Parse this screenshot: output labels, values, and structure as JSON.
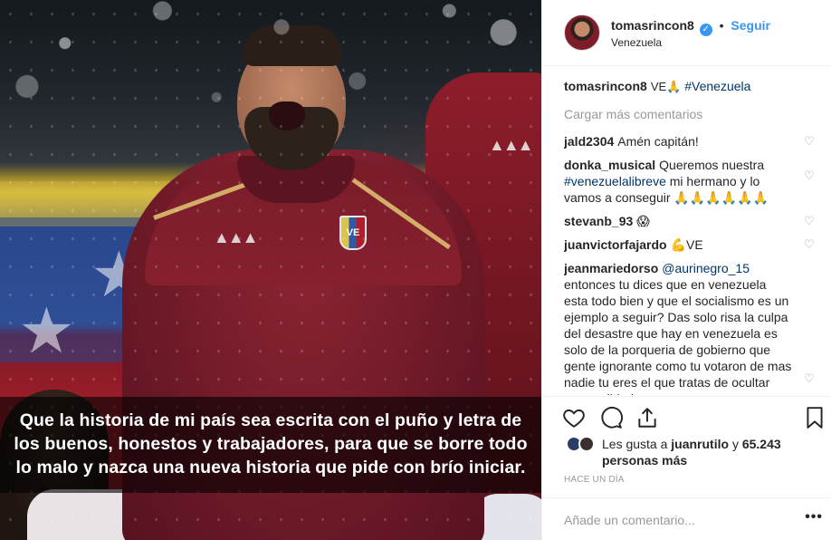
{
  "post": {
    "caption_overlay": "Que la historia de mi país sea escrita con el puño y letra de los buenos, honestos y trabajadores, para que se borre todo lo malo y nazca una nueva historia que pide con brío iniciar.",
    "crest_text": "VE"
  },
  "header": {
    "username": "tomasrincon8",
    "follow_label": "Seguir",
    "location": "Venezuela",
    "separator": "•"
  },
  "caption": {
    "username": "tomasrincon8",
    "text": "VE🙏",
    "hashtag": "#Venezuela"
  },
  "load_more_label": "Cargar más comentarios",
  "comments": [
    {
      "username": "jald2304",
      "text": "Amén capitán!",
      "mention": ""
    },
    {
      "username": "donka_musical",
      "text": "Queremos nuestra",
      "mention": "#venezuelalibreve",
      "text_after": " mi hermano y lo vamos a conseguir 🙏🙏🙏🙏🙏🙏"
    },
    {
      "username": "stevanb_93",
      "text": "😱",
      "mention": ""
    },
    {
      "username": "juanvictorfajardo",
      "text": "💪VE",
      "mention": ""
    },
    {
      "username": "jeanmariedorso",
      "mention": "@aurinegro_15",
      "text": "entonces tu dices que en venezuela esta todo bien y que el socialismo es un ejemplo a seguir? Das solo risa la culpa del desastre que hay en venezuela es solo de la porqueria de gobierno que gente ignorante como tu votaron de mas nadie tu eres el que tratas de ocultar una realidad que es"
    }
  ],
  "likes": {
    "prefix": "Les gusta a",
    "user": "juanrutilo",
    "conj": "y",
    "count": "65.243 personas más"
  },
  "timestamp": "HACE UN DÍA",
  "add_comment": {
    "placeholder": "Añade un comentario...",
    "more": "•••"
  },
  "icons": [
    "heart-icon",
    "comment-icon",
    "share-icon",
    "bookmark-icon",
    "verified-icon",
    "more-options-icon"
  ],
  "colors": {
    "link": "#3897f0",
    "hashtag": "#003569",
    "muted": "#999999",
    "text": "#262626"
  }
}
